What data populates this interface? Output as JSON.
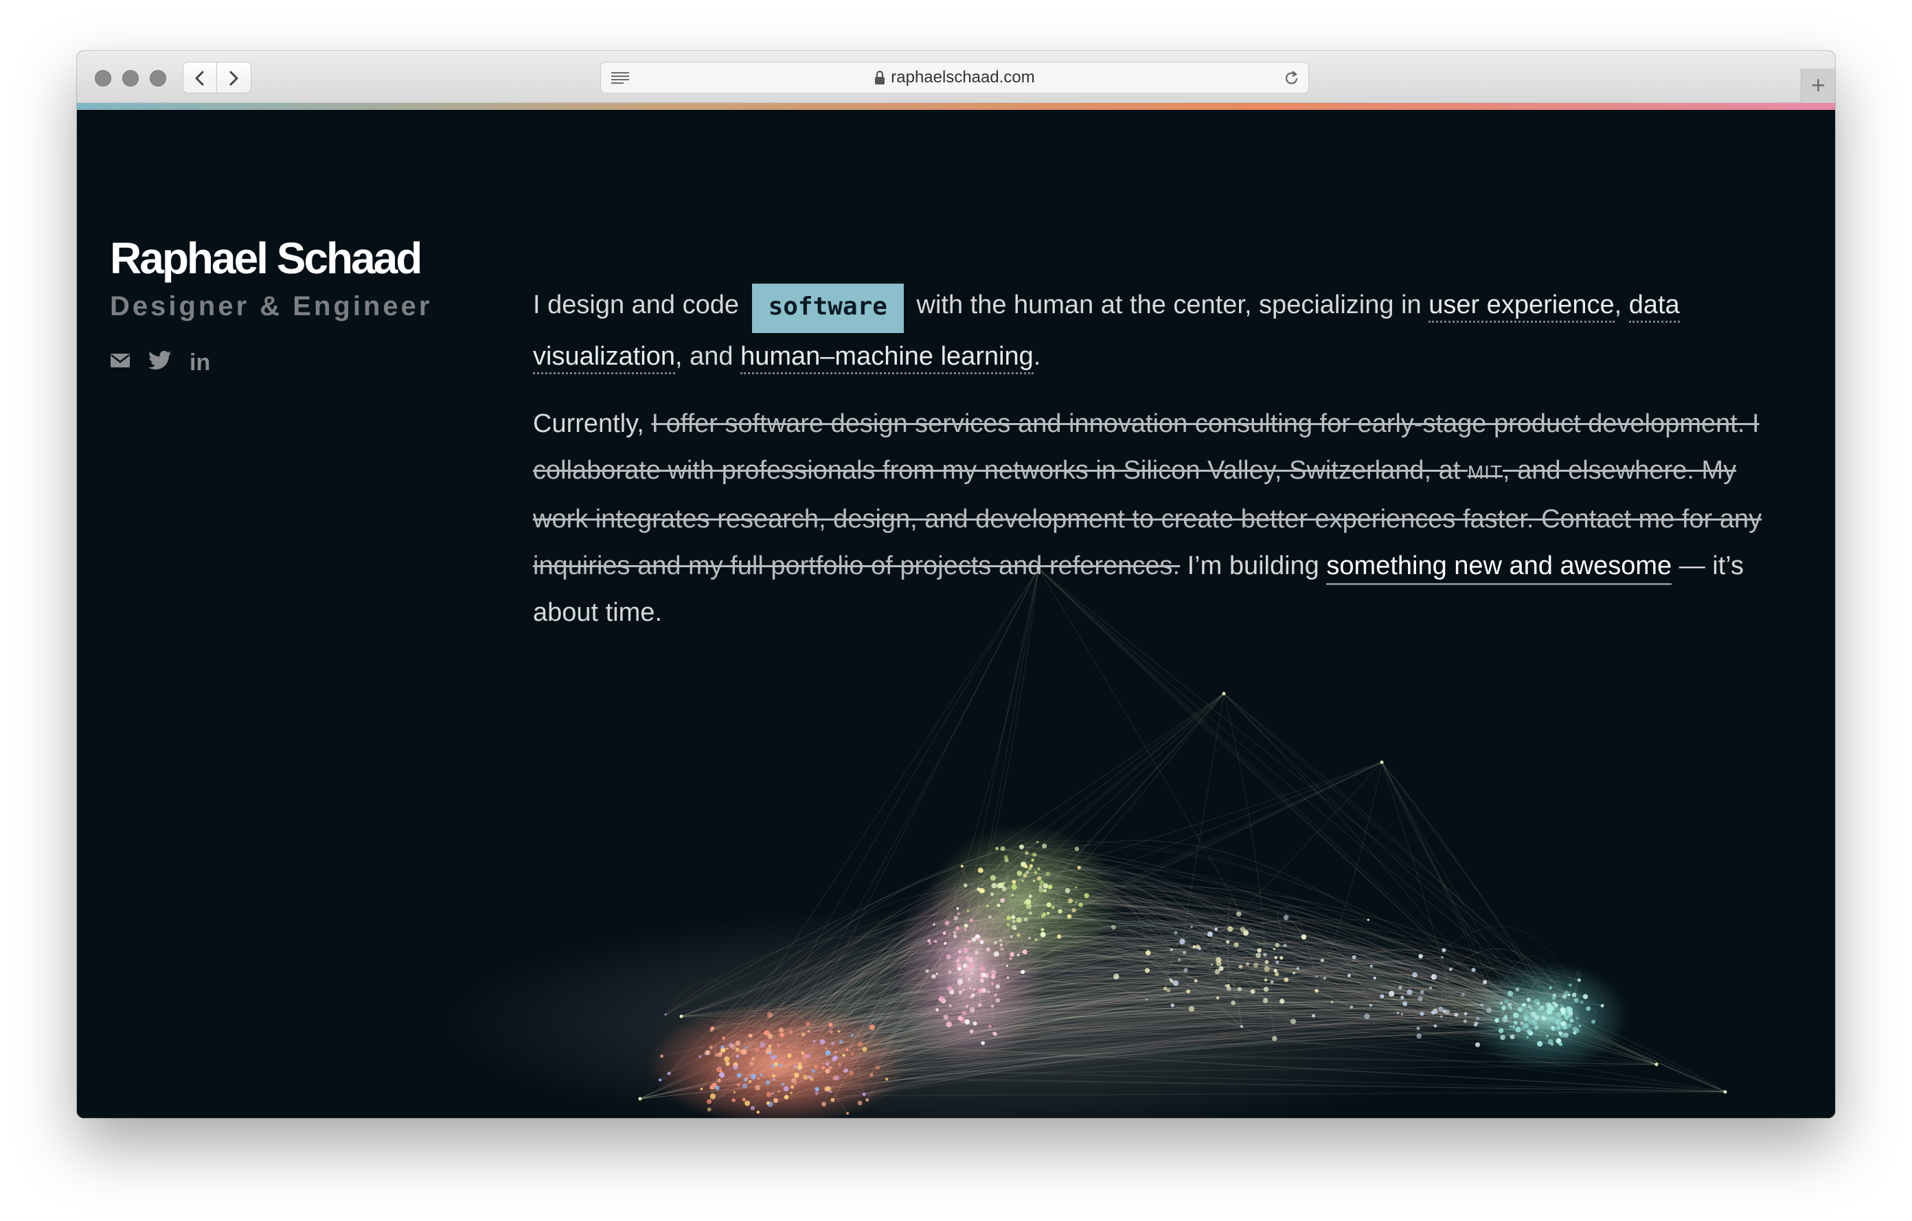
{
  "browser": {
    "url": "raphaelschaad.com",
    "new_tab_glyph": "+"
  },
  "hero": {
    "name": "Raphael Schaad",
    "role": "Designer & Engineer",
    "social": [
      "envelope-icon",
      "twitter-icon",
      "linkedin-icon"
    ],
    "linkedin_label": "in"
  },
  "intro": {
    "p1_before": "I design and code",
    "highlight": "software",
    "p1_middle": "with the human at the center, specializing in",
    "link_ux": "user experience",
    "comma": ",",
    "link_dataviz": "data visualization",
    "and": ", and",
    "link_hml": "human–machine learning",
    "period": ".",
    "currently": "Currently,",
    "struck_1": "I offer software design services and innovation consulting for early-stage product development. I collaborate with professionals from my networks in Silicon Valley, Switzerland, at",
    "struck_mit": "MIT",
    "struck_2": ", and elsewhere. My work integrates research, design, and development to create better experiences faster. Contact me for any inquiries and my full portfolio of projects and references.",
    "building": "I’m building",
    "link_new": "something new and awesome",
    "tail": "— it’s about time."
  },
  "colors": {
    "background": "#050f16",
    "highlight": "#8bbfcc",
    "strip": [
      "#7fb7c4",
      "#c9a27a",
      "#e98a5f",
      "#e58aa8"
    ]
  }
}
